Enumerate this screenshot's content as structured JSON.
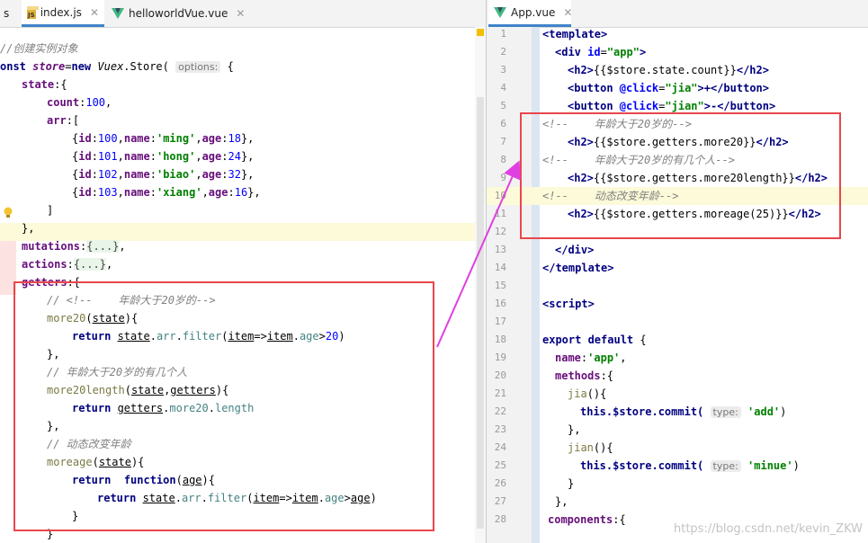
{
  "left_tabs": [
    {
      "label": "s",
      "icon": "js-file-icon",
      "closable": true
    },
    {
      "label": "index.js",
      "icon": "js-file-icon",
      "closable": true
    },
    {
      "label": "helloworldVue.vue",
      "icon": "vue-file-icon",
      "closable": true
    }
  ],
  "right_tabs": [
    {
      "label": "App.vue",
      "icon": "vue-file-icon",
      "closable": true
    }
  ],
  "left_code": {
    "l1": "//创建实例对象",
    "l2_kw": "onst ",
    "l2_var": "store",
    "l2_eq": "=",
    "l2_new": "new ",
    "l2_cls": "Vuex",
    "l2_store": ".Store(",
    "l2_hint": "options:",
    "l2_brace": " {",
    "state": "state",
    "state_open": ":{",
    "count": "count",
    "count_val": "100",
    "arr": "arr",
    "arr_open": ":[",
    "items": [
      {
        "id": "100",
        "name": "'ming'",
        "age": "18"
      },
      {
        "id": "101",
        "name": "'hong'",
        "age": "24"
      },
      {
        "id": "102",
        "name": "'biao'",
        "age": "32"
      },
      {
        "id": "103",
        "name": "'xiang'",
        "age": "16"
      }
    ],
    "arr_close": "]",
    "state_close": "},",
    "mutations": "mutations",
    "mutations_fold": "{...}",
    "actions": "actions",
    "actions_fold": "{...}",
    "getters": "getters",
    "getters_open": ":{",
    "c1": "// <!--    年龄大于20岁的-->",
    "more20": "more20",
    "state_param": "state",
    "ret": "return ",
    "filter": "filter",
    "item": "item",
    "age": "age",
    "n20": "20",
    "c2": "// 年龄大于20岁的有几个人",
    "more20length": "more20length",
    "getters_param": "getters",
    "length": "length",
    "c3": "// 动态改变年龄",
    "moreage": "moreage",
    "function_kw": "function",
    "age_param": "age"
  },
  "right_line_numbers": [
    "1",
    "2",
    "3",
    "4",
    "5",
    "6",
    "7",
    "8",
    "9",
    "10",
    "11",
    "12",
    "13",
    "14",
    "15",
    "16",
    "17",
    "18",
    "19",
    "20",
    "21",
    "22",
    "23",
    "24",
    "25",
    "26",
    "27",
    "28"
  ],
  "right_code": {
    "template_open": "<template>",
    "div_open_a": "<div ",
    "div_id": "id",
    "div_val": "\"app\"",
    "div_close_a": ">",
    "h2_open": "<h2>",
    "h2_close": "</h2>",
    "state_count": "{{$store.state.count}}",
    "btn_open": "<button ",
    "click": "@click",
    "jia_val": "\"jia\"",
    "jia_text": ">+</button>",
    "jian_val": "\"jian\"",
    "jian_text": ">-</button>",
    "c1": "<!--    年龄大于20岁的-->",
    "more20": "{{$store.getters.more20}}",
    "c2": "<!--    年龄大于20岁的有几个人-->",
    "more20length": "{{$store.getters.more20length}}",
    "c3": "<!--    动态改变年龄-->",
    "moreage": "{{$store.getters.moreage(25)}}",
    "div_close": "</div>",
    "template_close": "</template>",
    "script_open": "<script>",
    "export_default": "export default",
    "brace_open": " {",
    "name_key": "name",
    "name_val": "'app'",
    "methods": "methods",
    "jia": "jia",
    "this_commit": "this.$store.commit(",
    "type_hint": "type:",
    "add_val": "'add'",
    "jian": "jian",
    "minue_val": "'minue'",
    "components": "components"
  },
  "watermark": "https://blog.csdn.net/kevin_ZKW"
}
